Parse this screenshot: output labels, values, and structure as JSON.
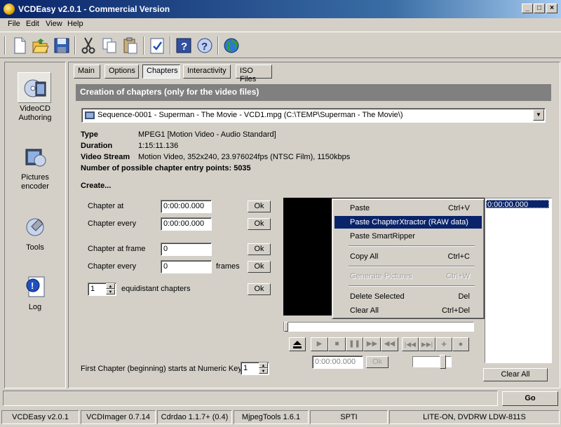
{
  "window": {
    "title": "VCDEasy v2.0.1 - Commercial Version",
    "min": "_",
    "max": "□",
    "close": "×"
  },
  "menu": [
    "File",
    "Edit",
    "View",
    "Help"
  ],
  "nav": [
    {
      "label": "VideoCD Authoring",
      "icon": "videocd-icon"
    },
    {
      "label": "Pictures encoder",
      "icon": "pictures-encoder-icon"
    },
    {
      "label": "Tools",
      "icon": "tools-icon"
    },
    {
      "label": "Log",
      "icon": "log-icon"
    }
  ],
  "tabs": [
    "Main",
    "Options",
    "Chapters",
    "Interactivity",
    "ISO Files"
  ],
  "header": "Creation of chapters (only for the video files)",
  "file_combo": "Sequence-0001 - Superman - The Movie - VCD1.mpg  (C:\\TEMP\\Superman - The Movie\\)",
  "info": {
    "type_label": "Type",
    "type_value": "MPEG1   [Motion Video - Audio Standard]",
    "duration_label": "Duration",
    "duration_value": "1:15:11.136",
    "stream_label": "Video Stream",
    "stream_value": "Motion Video, 352x240, 23.976024fps (NTSC Film), 1150kbps",
    "entries": "Number of possible chapter entry points: 5035"
  },
  "create_label": "Create...",
  "form": {
    "chapter_at": "Chapter at",
    "chapter_at_value": "0:00:00.000",
    "chapter_every": "Chapter every",
    "chapter_every_value": "0:00:00.000",
    "chapter_at_frame": "Chapter at frame",
    "chapter_at_frame_value": "0",
    "chapter_every2": "Chapter every",
    "chapter_every2_value": "0",
    "frames": "frames",
    "equidistant_value": "1",
    "equidistant": "equidistant chapters",
    "ok": "Ok"
  },
  "context_menu": [
    {
      "label": "Paste",
      "shortcut": "Ctrl+V",
      "state": "normal"
    },
    {
      "label": "Paste ChapterXtractor (RAW data)",
      "shortcut": "",
      "state": "highlight"
    },
    {
      "label": "Paste SmartRipper",
      "shortcut": "",
      "state": "normal"
    },
    {
      "label": "Copy All",
      "shortcut": "Ctrl+C",
      "state": "normal"
    },
    {
      "label": "Generate Pictures",
      "shortcut": "Ctrl+W",
      "state": "disabled"
    },
    {
      "label": "Delete Selected",
      "shortcut": "Del",
      "state": "normal"
    },
    {
      "label": "Clear All",
      "shortcut": "Ctrl+Del",
      "state": "normal"
    }
  ],
  "chapter_list": [
    "0:00:00.000"
  ],
  "player": {
    "time": "0:00:00.000",
    "ok": "Ok"
  },
  "clear_all": "Clear All",
  "first_chapter_label": "First Chapter (beginning) starts at Numeric Key",
  "first_chapter_value": "1",
  "go": "Go",
  "status": [
    "VCDEasy v2.0.1",
    "VCDImager 0.7.14",
    "Cdrdao 1.1.7+ (0.4)",
    "MjpegTools 1.6.1",
    "SPTI",
    "LITE-ON, DVDRW LDW-811S"
  ]
}
